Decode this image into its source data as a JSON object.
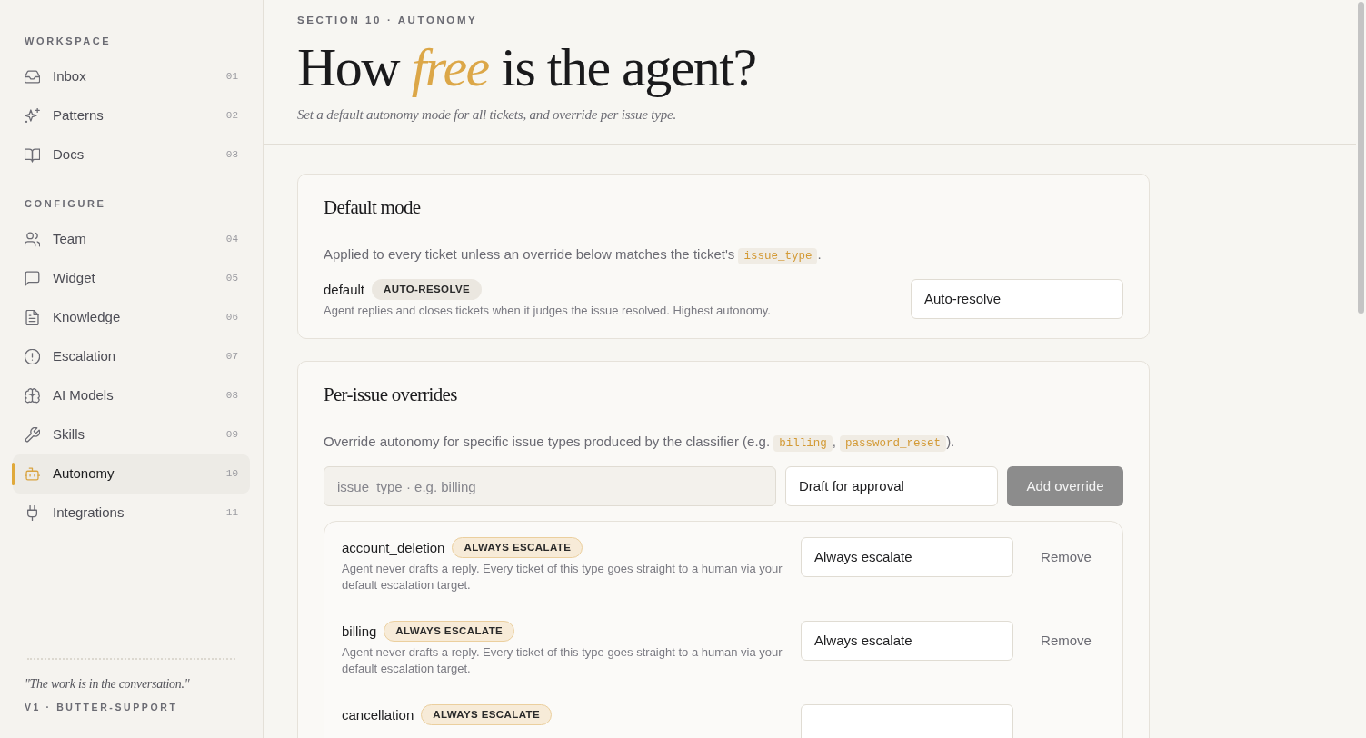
{
  "sidebar": {
    "sections": [
      {
        "label": "WORKSPACE",
        "items": [
          {
            "label": "Inbox",
            "number": "01",
            "selected": false
          },
          {
            "label": "Patterns",
            "number": "02",
            "selected": false
          },
          {
            "label": "Docs",
            "number": "03",
            "selected": false
          }
        ]
      },
      {
        "label": "CONFIGURE",
        "items": [
          {
            "label": "Team",
            "number": "04",
            "selected": false
          },
          {
            "label": "Widget",
            "number": "05",
            "selected": false
          },
          {
            "label": "Knowledge",
            "number": "06",
            "selected": false
          },
          {
            "label": "Escalation",
            "number": "07",
            "selected": false
          },
          {
            "label": "AI Models",
            "number": "08",
            "selected": false
          },
          {
            "label": "Skills",
            "number": "09",
            "selected": false
          },
          {
            "label": "Autonomy",
            "number": "10",
            "selected": true
          },
          {
            "label": "Integrations",
            "number": "11",
            "selected": false
          }
        ]
      }
    ],
    "quote": "\"The work is in the conversation.\"",
    "version": "V1 · BUTTER-SUPPORT"
  },
  "header": {
    "eyebrow": "SECTION 10 · AUTONOMY",
    "title": "How *free* is the agent?",
    "subtitle": "Set a default autonomy mode for all tickets, and override per issue type."
  },
  "default_mode": {
    "title": "Default mode",
    "description": [
      {
        "kind": "text",
        "text": "Applied to every ticket unless an override below matches the ticket's "
      },
      {
        "kind": "code",
        "text": "issue_type"
      },
      {
        "kind": "text",
        "text": "."
      }
    ],
    "rule": {
      "name": "default",
      "badge": {
        "text": "AUTO-RESOLVE",
        "kind": "neutral"
      },
      "description": "Agent replies and closes tickets when it judges the issue resolved. Highest autonomy.",
      "select": {
        "value": "Auto-resolve"
      }
    }
  },
  "overrides": {
    "title": "Per-issue overrides",
    "description": [
      {
        "kind": "text",
        "text": "Override autonomy for specific issue types produced by the classifier (e.g. "
      },
      {
        "kind": "code",
        "text": "billing"
      },
      {
        "kind": "text",
        "text": ", "
      },
      {
        "kind": "code",
        "text": "password_reset"
      },
      {
        "kind": "text",
        "text": ")."
      }
    ],
    "form": {
      "issue_type": {
        "placeholder": "issue_type · e.g. billing"
      },
      "mode": {
        "value": "Draft for approval"
      },
      "button": {
        "label": "Add override",
        "disabled": true
      }
    },
    "rules": [
      {
        "name": "account_deletion",
        "badge": {
          "text": "ALWAYS ESCALATE",
          "kind": "escalate"
        },
        "description": "Agent never drafts a reply. Every ticket of this type goes straight to a human via your default escalation target.",
        "select": {
          "value": "Always escalate"
        },
        "action": "Remove"
      },
      {
        "name": "billing",
        "badge": {
          "text": "ALWAYS ESCALATE",
          "kind": "escalate"
        },
        "description": "Agent never drafts a reply. Every ticket of this type goes straight to a human via your default escalation target.",
        "select": {
          "value": "Always escalate"
        },
        "action": "Remove"
      },
      {
        "name": "cancellation",
        "badge": {
          "text": "ALWAYS ESCALATE",
          "kind": "escalate"
        }
      }
    ]
  }
}
